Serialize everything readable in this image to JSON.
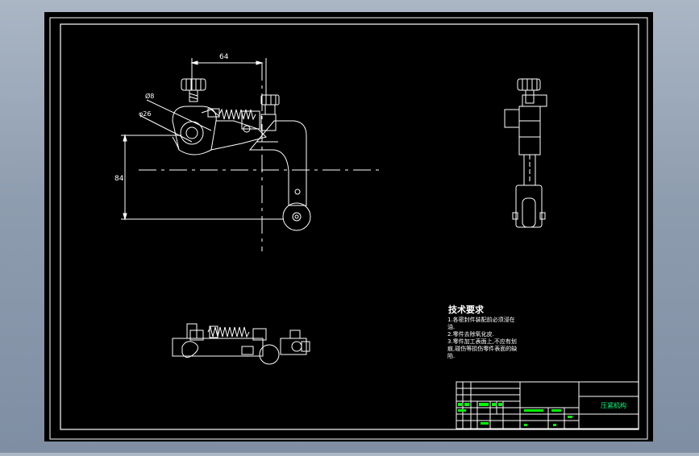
{
  "colors": {
    "background": "#8e9caf",
    "sheet": "#000000",
    "line": "#ffffff",
    "dimension": "#ffffff",
    "title_text": "#00ff7f",
    "table_text": "#00ff00"
  },
  "dimensions": {
    "width_64": "64",
    "dia_8": "Ø8",
    "dia_26": "φ26",
    "height_84": "84"
  },
  "tech_requirements": {
    "heading": "技术要求",
    "line1": "1.各密封件装配前必须浸在",
    "line2": "油.",
    "line3": "2.零件去除氧化皮.",
    "line4": "3.零件加工表面上,不应有划",
    "line5": "痕,碰伤等损伤零件表面的缺",
    "line6": "陷."
  },
  "title_block": {
    "drawing_name": "压紧机构"
  }
}
